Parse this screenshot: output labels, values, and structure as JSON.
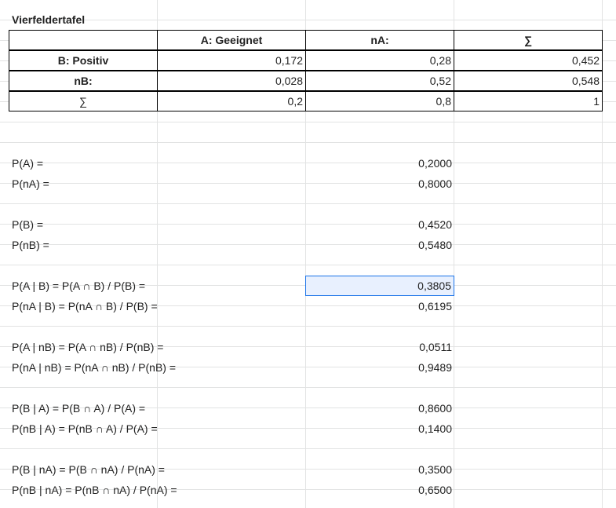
{
  "title": "Vierfeldertafel",
  "table": {
    "header": [
      "",
      "A: Geeignet",
      "nA:",
      "∑"
    ],
    "rows": [
      [
        "B: Positiv",
        "0,172",
        "0,28",
        "0,452"
      ],
      [
        "nB:",
        "0,028",
        "0,52",
        "0,548"
      ],
      [
        "∑",
        "0,2",
        "0,8",
        "1"
      ]
    ]
  },
  "calc": [
    {
      "label": "P(A) =",
      "value": "0,2000"
    },
    {
      "label": "P(nA) =",
      "value": "0,8000"
    },
    {
      "label": "P(B) =",
      "value": "0,4520"
    },
    {
      "label": "P(nB) =",
      "value": "0,5480"
    },
    {
      "label": "P(A | B) = P(A ∩ B) / P(B) =",
      "value": "0,3805"
    },
    {
      "label": "P(nA | B) = P(nA ∩ B) / P(B) =",
      "value": "0,6195"
    },
    {
      "label": "P(A | nB) = P(A ∩ nB) / P(nB) =",
      "value": "0,0511"
    },
    {
      "label": "P(nA | nB) = P(nA ∩ nB) / P(nB) =",
      "value": "0,9489"
    },
    {
      "label": "P(B | A) = P(B ∩ A) / P(A) =",
      "value": "0,8600"
    },
    {
      "label": "P(nB | A) = P(nB ∩ A) / P(A) =",
      "value": "0,1400"
    },
    {
      "label": "P(B | nA) = P(B ∩ nA) / P(nA) =",
      "value": "0,3500"
    },
    {
      "label": "P(nB | nA) = P(nB ∩ nA) / P(nA) =",
      "value": "0,6500"
    }
  ],
  "colors": {
    "grid": "#e2e3e3",
    "selection_border": "#1a73e8",
    "selection_fill": "#e8f0fe"
  }
}
